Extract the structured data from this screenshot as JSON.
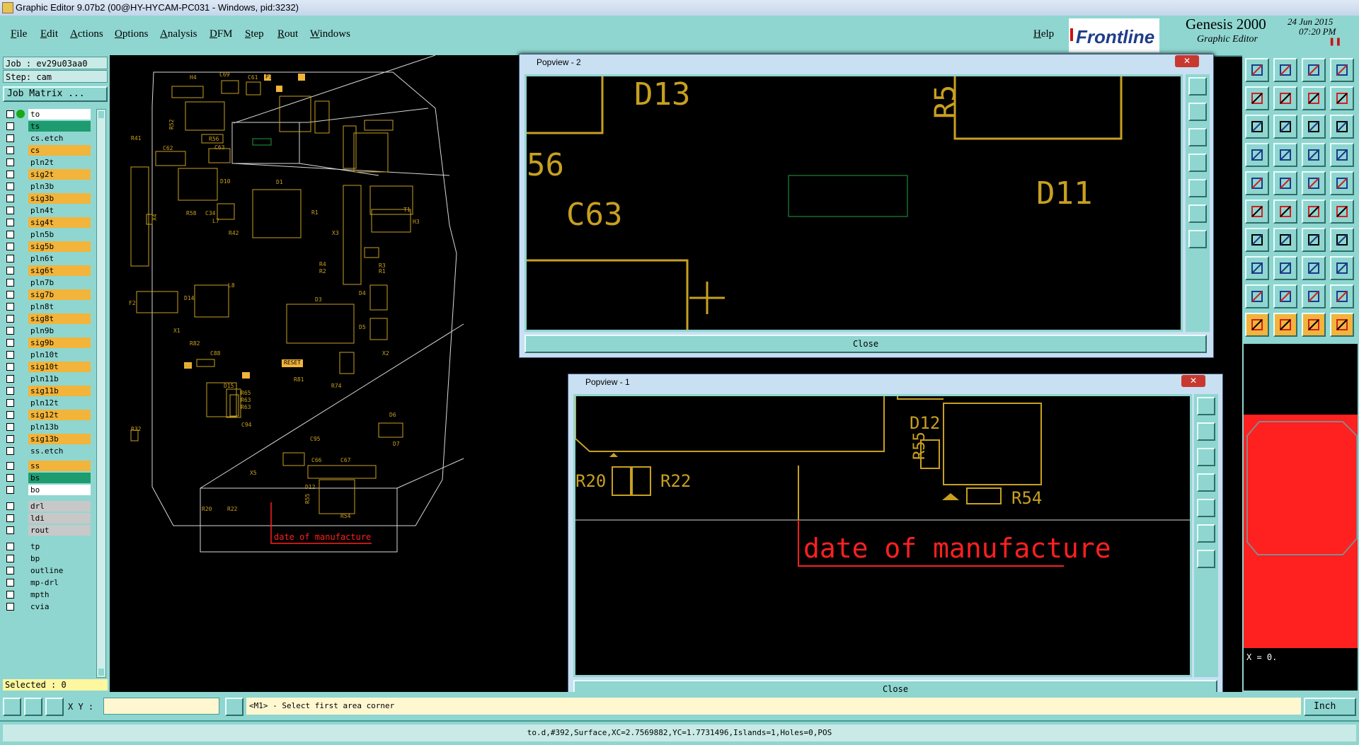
{
  "window": {
    "title": "Graphic Editor 9.07b2 (00@HY-HYCAM-PC031 - Windows, pid:3232)"
  },
  "menu": {
    "items": [
      "File",
      "Edit",
      "Actions",
      "Options",
      "Analysis",
      "DFM",
      "Step",
      "Rout",
      "Windows"
    ],
    "help": "Help"
  },
  "brand": {
    "logo": "Frontline",
    "product": "Genesis 2000",
    "subtitle": "Graphic Editor",
    "date": "24 Jun 2015",
    "time": "07:20 PM"
  },
  "job": {
    "job_label": "Job : ev29u03aa0",
    "step_label": "Step: cam",
    "matrix_button": "Job Matrix ..."
  },
  "layers": [
    {
      "name": "to",
      "style": "white",
      "active": true
    },
    {
      "name": "ts",
      "style": "teal"
    },
    {
      "name": "cs.etch",
      "style": "cyan"
    },
    {
      "name": "cs",
      "style": "orange"
    },
    {
      "name": "pln2t",
      "style": "cyan"
    },
    {
      "name": "sig2t",
      "style": "orange"
    },
    {
      "name": "pln3b",
      "style": "cyan"
    },
    {
      "name": "sig3b",
      "style": "orange"
    },
    {
      "name": "pln4t",
      "style": "cyan"
    },
    {
      "name": "sig4t",
      "style": "orange"
    },
    {
      "name": "pln5b",
      "style": "cyan"
    },
    {
      "name": "sig5b",
      "style": "orange"
    },
    {
      "name": "pln6t",
      "style": "cyan"
    },
    {
      "name": "sig6t",
      "style": "orange"
    },
    {
      "name": "pln7b",
      "style": "cyan"
    },
    {
      "name": "sig7b",
      "style": "orange"
    },
    {
      "name": "pln8t",
      "style": "cyan"
    },
    {
      "name": "sig8t",
      "style": "orange"
    },
    {
      "name": "pln9b",
      "style": "cyan"
    },
    {
      "name": "sig9b",
      "style": "orange"
    },
    {
      "name": "pln10t",
      "style": "cyan"
    },
    {
      "name": "sig10t",
      "style": "orange"
    },
    {
      "name": "pln11b",
      "style": "cyan"
    },
    {
      "name": "sig11b",
      "style": "orange"
    },
    {
      "name": "pln12t",
      "style": "cyan"
    },
    {
      "name": "sig12t",
      "style": "orange"
    },
    {
      "name": "pln13b",
      "style": "cyan"
    },
    {
      "name": "sig13b",
      "style": "orange"
    },
    {
      "name": "ss.etch",
      "style": "cyan"
    },
    {
      "name": "ss",
      "style": "orange"
    },
    {
      "name": "bs",
      "style": "teal"
    },
    {
      "name": "bo",
      "style": "white"
    },
    {
      "name": "drl",
      "style": "gray"
    },
    {
      "name": "ldi",
      "style": "gray"
    },
    {
      "name": "rout",
      "style": "gray"
    },
    {
      "name": "tp",
      "style": "cyan"
    },
    {
      "name": "bp",
      "style": "cyan"
    },
    {
      "name": "outline",
      "style": "cyan"
    },
    {
      "name": "mp-drl",
      "style": "cyan"
    },
    {
      "name": "mpth",
      "style": "cyan"
    },
    {
      "name": "cvia",
      "style": "cyan"
    }
  ],
  "selected": "Selected : 0",
  "canvas": {
    "annotation": "date of manufacture",
    "refdes": [
      "D13",
      "D11",
      "D12",
      "D10",
      "D14",
      "D15",
      "D1",
      "D3",
      "D4",
      "D5",
      "D6",
      "D7",
      "X1",
      "X2",
      "X3",
      "X4",
      "X5",
      "C61",
      "C62",
      "C63",
      "C69",
      "C84",
      "C88",
      "C66",
      "C67",
      "C94",
      "C95",
      "R52",
      "R56",
      "R58",
      "R20",
      "R22",
      "R32",
      "R49",
      "R54",
      "R55",
      "R65",
      "R63",
      "R81",
      "R74",
      "RESET",
      "T1",
      "H3",
      "L7",
      "L8",
      "L9",
      "C34",
      "C38",
      "R42"
    ]
  },
  "popview2": {
    "title": "Popview - 2",
    "close": "Close",
    "labels": [
      "D13",
      "R5",
      "56",
      "C63",
      "D11"
    ]
  },
  "popview1": {
    "title": "Popview - 1",
    "close": "Close",
    "labels": [
      "D12",
      "R55",
      "R20",
      "R22",
      "R54"
    ],
    "annotation": "date of manufacture"
  },
  "coords": {
    "xy_label": "X Y :",
    "xy_value": "",
    "prompt": "<M1> - Select first area corner",
    "x_readout": "X = 0.",
    "units": "Inch"
  },
  "status": {
    "text": "to.d,#392,Surface,XC=2.7569882,YC=1.7731496,Islands=1,Holes=0,POS"
  },
  "colors": {
    "panel": "#8fd6d0",
    "signal_layer": "#f2b43a",
    "board_features": "#c8a020",
    "annotation": "#ff2020",
    "preview_fill": "#ff2020"
  }
}
